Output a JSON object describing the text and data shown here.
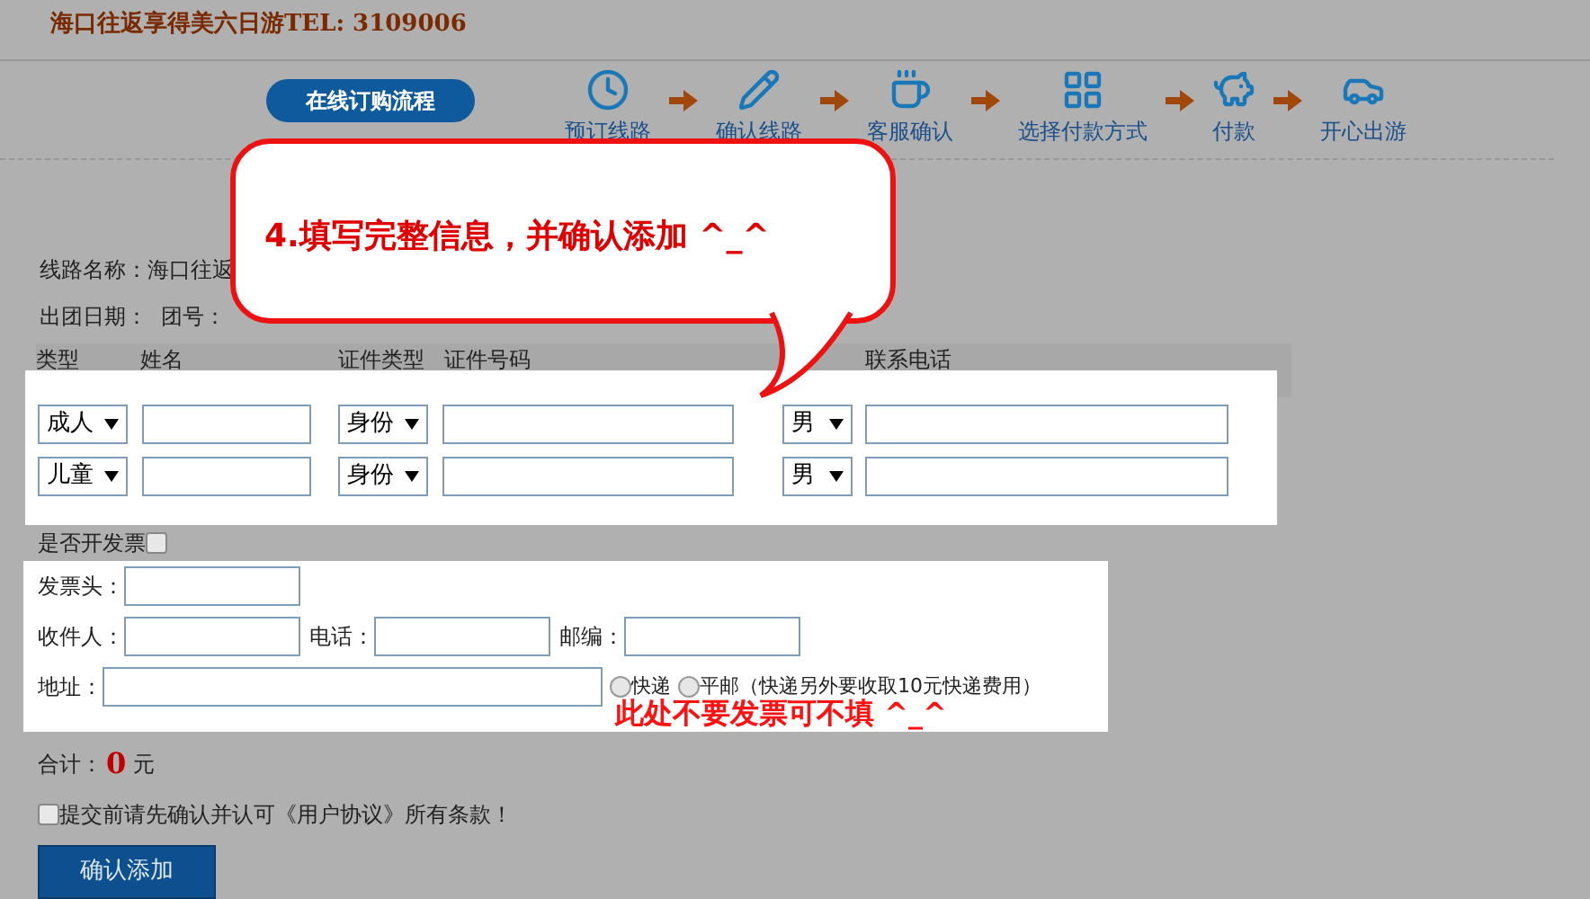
{
  "header": {
    "title": "海口往返享得美六日游TEL: 3109006"
  },
  "process": {
    "badge": "在线订购流程",
    "steps": [
      {
        "label": "预订线路"
      },
      {
        "label": "确认线路"
      },
      {
        "label": "客服确认"
      },
      {
        "label": "选择付款方式"
      },
      {
        "label": "付款"
      },
      {
        "label": "开心出游"
      }
    ]
  },
  "callout": {
    "text": "4.填写完整信息，并确认添加 ^_^"
  },
  "info": [
    "线路名称：海口往返",
    "出团日期：  团号："
  ],
  "table": {
    "columns": [
      "类型",
      "姓名",
      "证件类型",
      "证件号码",
      "联系电话"
    ],
    "rows": [
      {
        "type": "成人",
        "id_type": "身份",
        "gender": "男"
      },
      {
        "type": "儿童",
        "id_type": "身份",
        "gender": "男"
      }
    ]
  },
  "invoice_toggle": {
    "label": "是否开发票",
    "checked": false
  },
  "invoice": {
    "title_label": "发票头：",
    "recipient_label": "收件人：",
    "phone_label": "电话：",
    "postcode_label": "邮编：",
    "address_label": "地址：",
    "shipping": [
      {
        "label": "快递",
        "selected": false
      },
      {
        "label": "平邮（快递另外要收取10元快递费用）",
        "selected": false
      }
    ]
  },
  "note": {
    "text": "此处不要发票可不填 ^_^"
  },
  "total": {
    "label": "合计：",
    "amount": "0",
    "unit": "元"
  },
  "agreement": {
    "label": "提交前请先确认并认可《用户协议》所有条款！",
    "checked": false
  },
  "submit": "确认添加"
}
